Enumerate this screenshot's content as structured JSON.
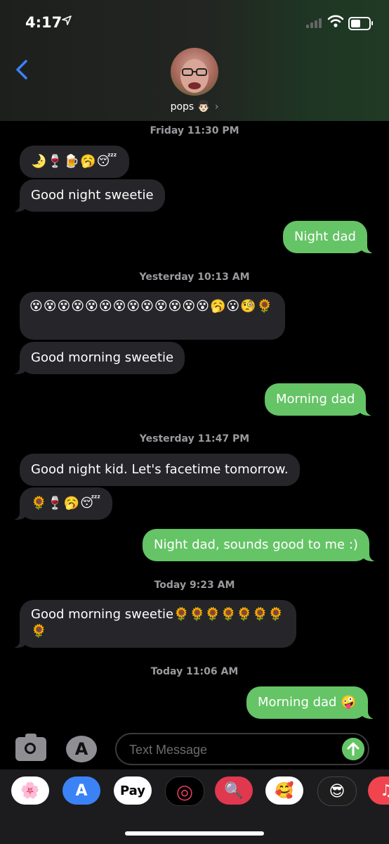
{
  "status": {
    "time": "4:17",
    "location_icon": "location-arrow-icon"
  },
  "contact": {
    "name": "pops",
    "memoji": "👨🏻",
    "chevron": "›"
  },
  "messages": [
    {
      "id": "ts1",
      "type": "timestamp",
      "text": "Friday 11:30 PM"
    },
    {
      "id": "m1",
      "from": "them",
      "text": "🌛🍷🍺🥱😴"
    },
    {
      "id": "m2",
      "from": "them",
      "text": "Good night sweetie"
    },
    {
      "id": "m3",
      "from": "me",
      "text": "Night dad"
    },
    {
      "id": "ts2",
      "type": "timestamp",
      "text": "Yesterday 10:13 AM"
    },
    {
      "id": "m4",
      "from": "them",
      "text": "😵😵😵😵😵😵😵😵😵😵😵😵😵🥱😮🧐🌻"
    },
    {
      "id": "m5",
      "from": "them",
      "text": "Good morning sweetie"
    },
    {
      "id": "m6",
      "from": "me",
      "text": "Morning dad"
    },
    {
      "id": "ts3",
      "type": "timestamp",
      "text": "Yesterday 11:47 PM"
    },
    {
      "id": "m7",
      "from": "them",
      "text": "Good night kid. Let's facetime tomorrow."
    },
    {
      "id": "m8",
      "from": "them",
      "text": "🌻🍷🥱😴"
    },
    {
      "id": "m9",
      "from": "me",
      "text": "Night dad, sounds good to me :)"
    },
    {
      "id": "ts4",
      "type": "timestamp",
      "text": "Today 9:23 AM"
    },
    {
      "id": "m10",
      "from": "them",
      "text": "Good morning sweetie🌻🌻🌻🌻🌻🌻🌻🌻"
    },
    {
      "id": "ts5",
      "type": "timestamp",
      "text": "Today 11:06 AM"
    },
    {
      "id": "m11",
      "from": "me",
      "text": "Morning dad 🤪"
    }
  ],
  "composer": {
    "placeholder": "Text Message"
  },
  "app_drawer": [
    {
      "name": "photos-app-icon",
      "glyph": "🌸"
    },
    {
      "name": "app-store-app-icon",
      "glyph": "A"
    },
    {
      "name": "apple-pay-app-icon",
      "glyph": "Pay"
    },
    {
      "name": "activity-app-icon",
      "glyph": "◎"
    },
    {
      "name": "web-search-app-icon",
      "glyph": "🔍"
    },
    {
      "name": "memoji-stickers-app-icon",
      "glyph": "🥰"
    },
    {
      "name": "animoji-app-icon",
      "glyph": "😎"
    },
    {
      "name": "music-app-icon",
      "glyph": "♫"
    }
  ],
  "colors": {
    "sent": "#65c466",
    "received": "#26262a",
    "link": "#3b82f6"
  }
}
